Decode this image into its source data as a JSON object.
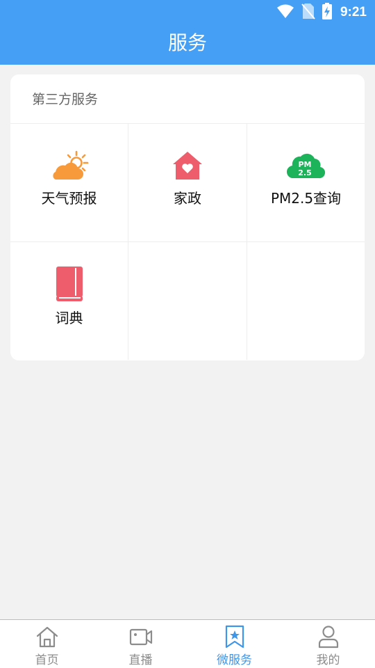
{
  "status_bar": {
    "time": "9:21",
    "icons": [
      "wifi-icon",
      "no-sim-icon",
      "battery-charging-icon"
    ]
  },
  "header": {
    "title": "服务"
  },
  "section": {
    "title": "第三方服务",
    "items": [
      {
        "label": "天气预报",
        "icon": "weather-icon"
      },
      {
        "label": "家政",
        "icon": "housekeeping-icon"
      },
      {
        "label": "PM2.5查询",
        "icon": "pm25-icon",
        "icon_text_top": "PM",
        "icon_text_bottom": "2.5"
      },
      {
        "label": "词典",
        "icon": "dictionary-icon"
      }
    ]
  },
  "tabbar": {
    "active_index": 2,
    "active_color": "#3d96ea",
    "items": [
      {
        "label": "首页",
        "icon": "home-icon"
      },
      {
        "label": "直播",
        "icon": "video-icon"
      },
      {
        "label": "微服务",
        "icon": "bookmark-star-icon"
      },
      {
        "label": "我的",
        "icon": "user-icon"
      }
    ]
  },
  "colors": {
    "header_bg": "#45a0f5",
    "weather": "#f79a3b",
    "housekeeping": "#ee5d6c",
    "pm25": "#1db35b",
    "dictionary": "#ee5d6c"
  }
}
